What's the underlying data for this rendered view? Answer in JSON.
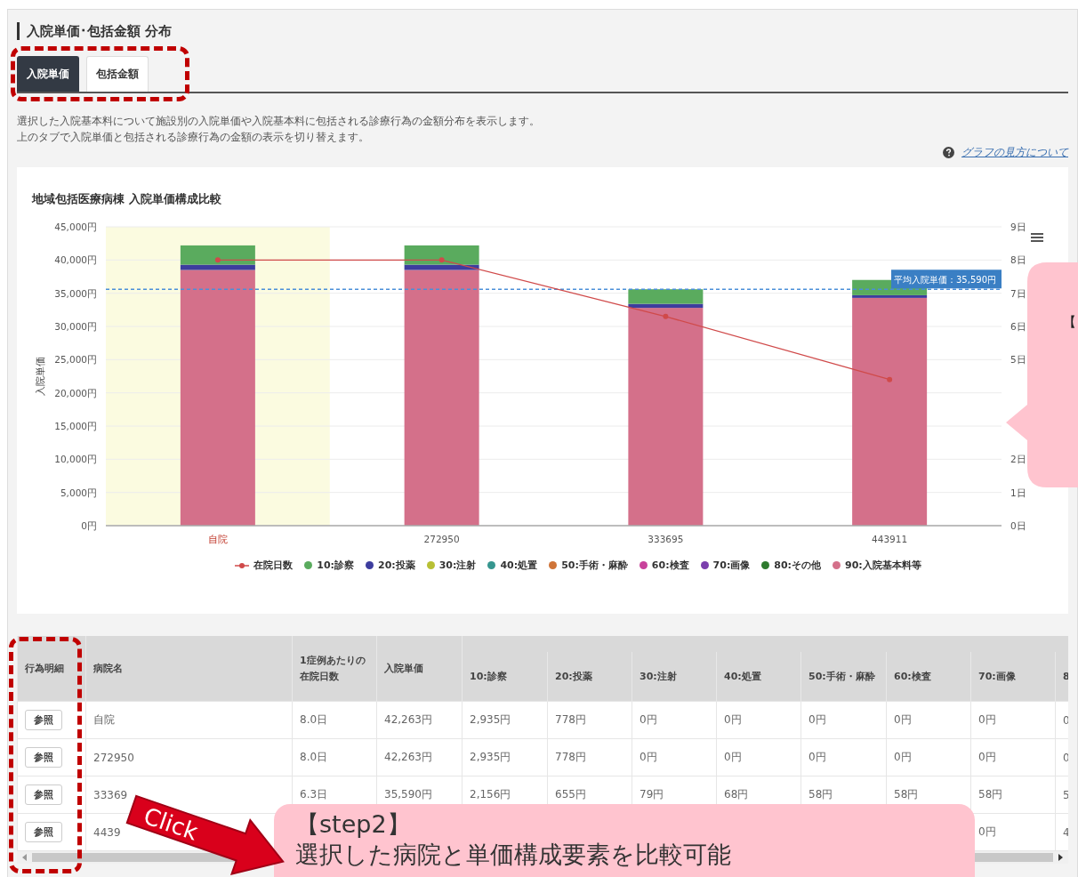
{
  "section": {
    "title": "入院単価･包括金額 分布"
  },
  "tabs": [
    {
      "label": "入院単価",
      "selected": true
    },
    {
      "label": "包括金額",
      "selected": false
    }
  ],
  "description": [
    "選択した入院基本料について施設別の入院単価や入院基本料に包括される診療行為の金額分布を表示します。",
    "上のタブで入院単価と包括される診療行為の金額の表示を切り替えます。"
  ],
  "help_link": "グラフの見方について",
  "chart": {
    "chart_data": {
      "type": "bar",
      "stacked": true,
      "title": "地域包括医療病棟 入院単価構成比較",
      "ylabel": "入院単価",
      "grid": true,
      "legend": "bottom",
      "categories": [
        "自院",
        "272950",
        "333695",
        "443911"
      ],
      "ylim": [
        0,
        45000
      ],
      "yticks": [
        {
          "value": 0,
          "label": "0円"
        },
        {
          "value": 5000,
          "label": "5,000円"
        },
        {
          "value": 10000,
          "label": "10,000円"
        },
        {
          "value": 15000,
          "label": "15,000円"
        },
        {
          "value": 20000,
          "label": "20,000円"
        },
        {
          "value": 25000,
          "label": "25,000円"
        },
        {
          "value": 30000,
          "label": "30,000円"
        },
        {
          "value": 35000,
          "label": "35,000円"
        },
        {
          "value": 40000,
          "label": "40,000円"
        },
        {
          "value": 45000,
          "label": "45,000円"
        }
      ],
      "y2lim": [
        0,
        9
      ],
      "y2ticks": [
        {
          "value": 0,
          "label": "0日"
        },
        {
          "value": 1,
          "label": "1日"
        },
        {
          "value": 2,
          "label": "2日"
        },
        {
          "value": 5,
          "label": "5日"
        },
        {
          "value": 6,
          "label": "6日"
        },
        {
          "value": 7,
          "label": "7日"
        },
        {
          "value": 8,
          "label": "8日"
        },
        {
          "value": 9,
          "label": "9日"
        }
      ],
      "series": [
        {
          "name": "在院日数",
          "type": "line",
          "axis": "y2",
          "marker": "o",
          "color": "#d04a4a",
          "values": [
            8,
            8,
            6.3,
            4.4
          ]
        },
        {
          "name": "90:入院基本料等",
          "color": "#d4708a",
          "values": [
            38500,
            38500,
            32800,
            34300
          ]
        },
        {
          "name": "80:その他",
          "color": "#2d7a2d",
          "values": [
            0,
            0,
            0,
            0
          ]
        },
        {
          "name": "70:画像",
          "color": "#7b3fad",
          "values": [
            0,
            0,
            0,
            0
          ]
        },
        {
          "name": "60:検査",
          "color": "#c8429b",
          "values": [
            0,
            0,
            0,
            0
          ]
        },
        {
          "name": "50:手術・麻酔",
          "color": "#cf7438",
          "values": [
            0,
            0,
            0,
            0
          ]
        },
        {
          "name": "40:処置",
          "color": "#36968f",
          "values": [
            0,
            0,
            0,
            0
          ]
        },
        {
          "name": "30:注射",
          "color": "#b8c034",
          "values": [
            0,
            0,
            0,
            0
          ]
        },
        {
          "name": "20:投薬",
          "color": "#3d3d9e",
          "values": [
            800,
            800,
            600,
            400
          ]
        },
        {
          "name": "10:診察",
          "color": "#5aab5e",
          "values": [
            2900,
            2900,
            2200,
            2300
          ]
        }
      ],
      "ref_lines": [
        {
          "axis": "y",
          "value": 35590,
          "label": "平均入院単価：35,590円"
        }
      ],
      "bands": [
        {
          "axis": "x",
          "from": "自院",
          "to": "自院"
        }
      ]
    }
  },
  "table": {
    "columns": [
      {
        "label": "行為明細",
        "kind": "button"
      },
      {
        "label": "病院名",
        "kind": "main"
      },
      {
        "label": "1症例あたりの在院日数",
        "kind": "main"
      },
      {
        "label": "入院単価",
        "kind": "main"
      },
      {
        "label": "10:診察",
        "kind": "component"
      },
      {
        "label": "20:投薬",
        "kind": "component"
      },
      {
        "label": "30:注射",
        "kind": "component"
      },
      {
        "label": "40:処置",
        "kind": "component"
      },
      {
        "label": "50:手術・麻酔",
        "kind": "component"
      },
      {
        "label": "60:検査",
        "kind": "component"
      },
      {
        "label": "70:画像",
        "kind": "component"
      },
      {
        "label": "8",
        "kind": "component"
      }
    ],
    "rows": [
      {
        "cells": [
          "参照",
          "自院",
          "8.0日",
          "42,263円",
          "2,935円",
          "778円",
          "0円",
          "0円",
          "0円",
          "0円",
          "0円",
          "0"
        ]
      },
      {
        "cells": [
          "参照",
          "272950",
          "8.0日",
          "42,263円",
          "2,935円",
          "778円",
          "0円",
          "0円",
          "0円",
          "0円",
          "0円",
          "0"
        ]
      },
      {
        "cells": [
          "参照",
          "33369",
          "6.3日",
          "35,590円",
          "2,156円",
          "655円",
          "79円",
          "68円",
          "58円",
          "58円",
          "58円",
          "5"
        ]
      },
      {
        "cells": [
          "参照",
          "4439",
          null,
          null,
          null,
          null,
          null,
          null,
          null,
          null,
          "0円",
          "4"
        ]
      }
    ]
  },
  "overlays": {
    "click_arrow": "Click",
    "callouts": [
      {
        "kind": "side",
        "lines": [
          "【"
        ]
      },
      {
        "kind": "step",
        "lines": [
          "【step2】",
          "選択した病院と単価構成要素を比較可能"
        ]
      }
    ]
  }
}
